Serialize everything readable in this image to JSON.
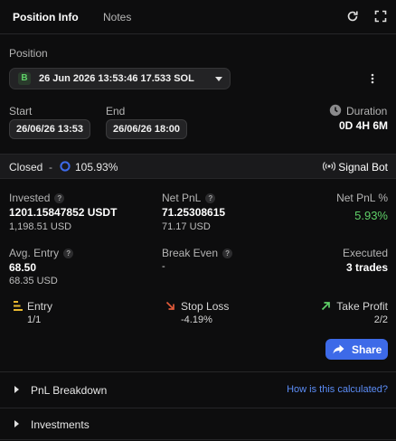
{
  "tabs": [
    {
      "label": "Position Info"
    },
    {
      "label": "Notes"
    }
  ],
  "header_icons": [
    "refresh-icon",
    "fullscreen-icon"
  ],
  "position": {
    "label": "Position",
    "badge": "B",
    "selected": "26 Jun 2026 13:53:46 17.533 SOL"
  },
  "start": {
    "label": "Start",
    "value": "26/06/26 13:53"
  },
  "end": {
    "label": "End",
    "value": "26/06/26 18:00"
  },
  "duration": {
    "label": "Duration",
    "value": "0D 4H 6M"
  },
  "status": {
    "state": "Closed",
    "separator": "-",
    "progress": "105.93%",
    "bot": "Signal Bot"
  },
  "invested": {
    "label": "Invested",
    "value": "1201.15847852 USDT",
    "usd": "1,198.51 USD"
  },
  "net_pnl": {
    "label": "Net PnL",
    "value": "71.25308615",
    "usd": "71.17 USD"
  },
  "net_pnl_pct": {
    "label": "Net PnL %",
    "value": "5.93%"
  },
  "avg_entry": {
    "label": "Avg. Entry",
    "value": "68.50",
    "usd": "68.35 USD"
  },
  "break_even": {
    "label": "Break Even",
    "value": "-"
  },
  "executed": {
    "label": "Executed",
    "value": "3 trades"
  },
  "entry": {
    "label": "Entry",
    "value": "1/1"
  },
  "stop_loss": {
    "label": "Stop Loss",
    "value": "-4.19%"
  },
  "take_profit": {
    "label": "Take Profit",
    "value": "2/2"
  },
  "share_label": "Share",
  "pnl_breakdown": {
    "label": "PnL Breakdown",
    "link": "How is this calculated?"
  },
  "investments": {
    "label": "Investments"
  },
  "colors": {
    "accent": "#3d6ae8",
    "positive": "#5fd068",
    "negative": "#e05a3a",
    "link": "#5b8cf5"
  }
}
